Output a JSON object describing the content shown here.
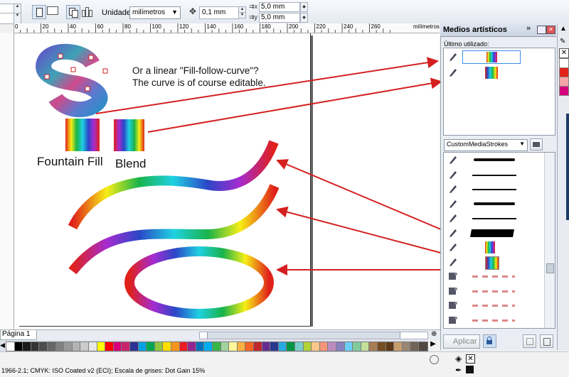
{
  "toolbar": {
    "units_label": "Unidades:",
    "units_value": "milímetros",
    "nudge_value": "0,1 mm",
    "dup_x": "5,0 mm",
    "dup_y": "5,0 mm"
  },
  "ruler": {
    "ticks": [
      "0",
      "20",
      "40",
      "60",
      "80",
      "100",
      "120",
      "140",
      "160",
      "180",
      "200",
      "220",
      "240",
      "260"
    ],
    "unit": "milímetros"
  },
  "canvas": {
    "note_line1": "Or a linear \"Fill-follow-curve\"?",
    "note_line2": "The curve is of course editable.",
    "label_fountain": "Fountain Fill",
    "label_blend": "Blend"
  },
  "docker": {
    "title": "Medios artísticos",
    "recent_label": "Último utilizado:",
    "dropdown_value": "CustomMediaStrokes",
    "apply_label": "Aplicar"
  },
  "page_tab": "Página 1",
  "status_text": "1966-2.1; CMYK: ISO Coated v2 (ECI); Escala de grises: Dot Gain 15%",
  "colors": {
    "accent": "#e2231a",
    "docker_header": "#c9d3e2",
    "palette": [
      "#ffffff",
      "#000000",
      "#1a1a1a",
      "#333333",
      "#4d4d4d",
      "#666666",
      "#808080",
      "#999999",
      "#b3b3b3",
      "#cccccc",
      "#e6e6e6",
      "#ffff00",
      "#ff0000",
      "#d7007a",
      "#c8246c",
      "#2e3192",
      "#00a0e3",
      "#00a651",
      "#8dc63f",
      "#ffde00",
      "#f7941d",
      "#ed1c24",
      "#92278f",
      "#0072bc",
      "#00aeef",
      "#39b54a",
      "#a3d39c",
      "#fff799",
      "#fbb040",
      "#f26522",
      "#c1272d",
      "#662d91",
      "#2b388f",
      "#27aae1",
      "#009444",
      "#7accc8",
      "#b2d235",
      "#fdc689",
      "#f69679",
      "#bd8cbf",
      "#8781bd",
      "#6dcff6",
      "#82ca9c",
      "#c4df9b",
      "#a67c52",
      "#754c24",
      "#5e3a1a",
      "#c69c6d",
      "#998675",
      "#736357",
      "#534741"
    ],
    "right_palette": [
      "#ffffff",
      "#e2231a",
      "#f6a5a8",
      "#d6007a"
    ]
  },
  "icons": [
    "page-portrait-icon",
    "page-landscape-icon",
    "pages-icon",
    "chevron-down-icon",
    "nudge-icon",
    "close-icon",
    "maximize-icon",
    "pin-icon",
    "eyedropper-icon",
    "no-color-icon",
    "folder-icon",
    "save-icon",
    "delete-icon",
    "lock-icon",
    "brush-icon",
    "zoom-icon",
    "fill-icon",
    "outline-icon"
  ]
}
